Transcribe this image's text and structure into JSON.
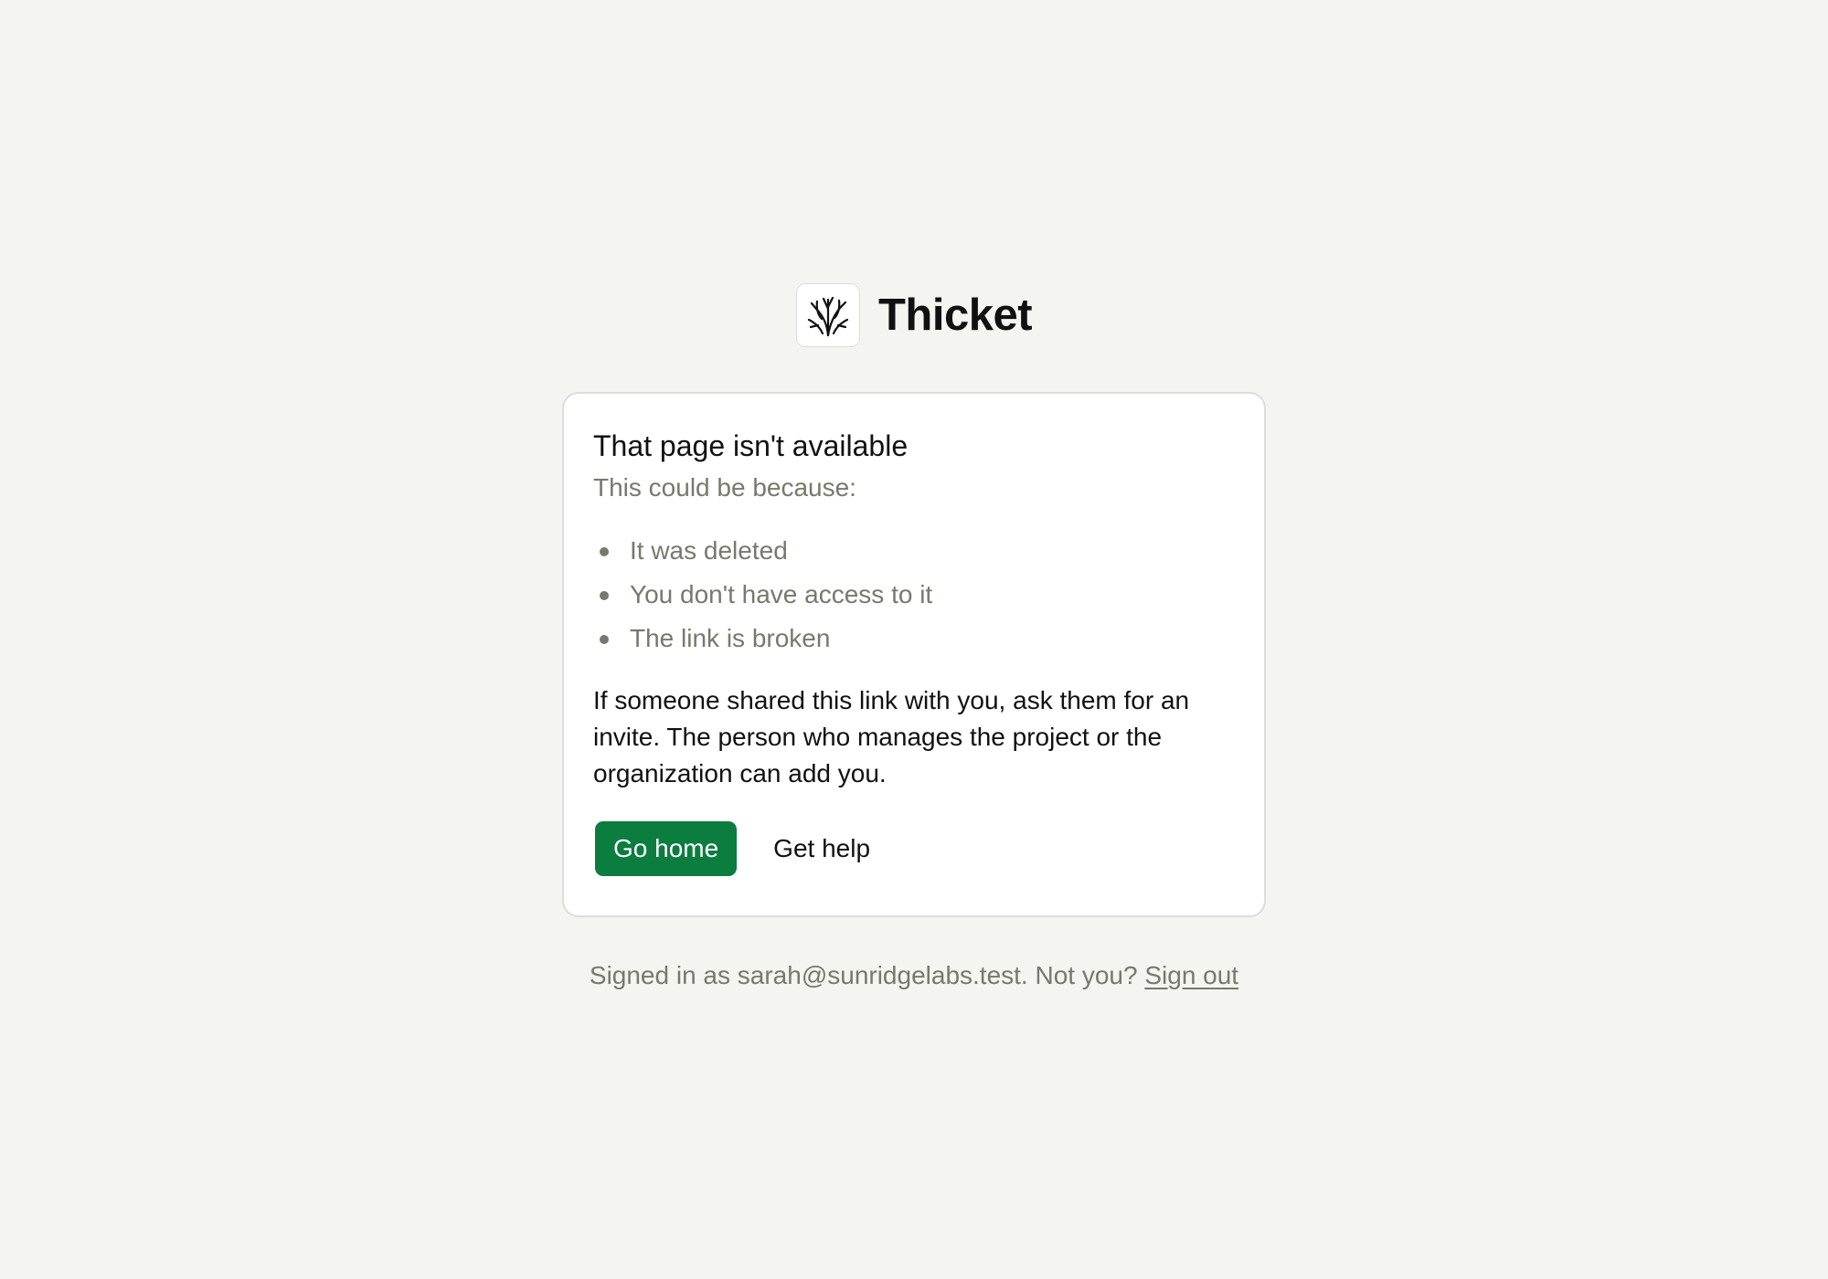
{
  "brand": {
    "name": "Thicket",
    "logo_icon": "thicket-branches-icon"
  },
  "card": {
    "title": "That page isn't available",
    "subtitle": "This could be because:",
    "reasons": [
      "It was deleted",
      "You don't have access to it",
      "The link is broken"
    ],
    "body": "If someone shared this link with you, ask them for an invite. The person who manages the project or the organization can add you.",
    "primary_button": "Go home",
    "secondary_button": "Get help"
  },
  "footer": {
    "signed_in_text": "Signed in as sarah@sunridgelabs.test. Not you?",
    "sign_out_link": "Sign out"
  },
  "colors": {
    "background": "#f4f4f0",
    "accent": "#0b7d3e",
    "muted_text": "#767a6d"
  }
}
